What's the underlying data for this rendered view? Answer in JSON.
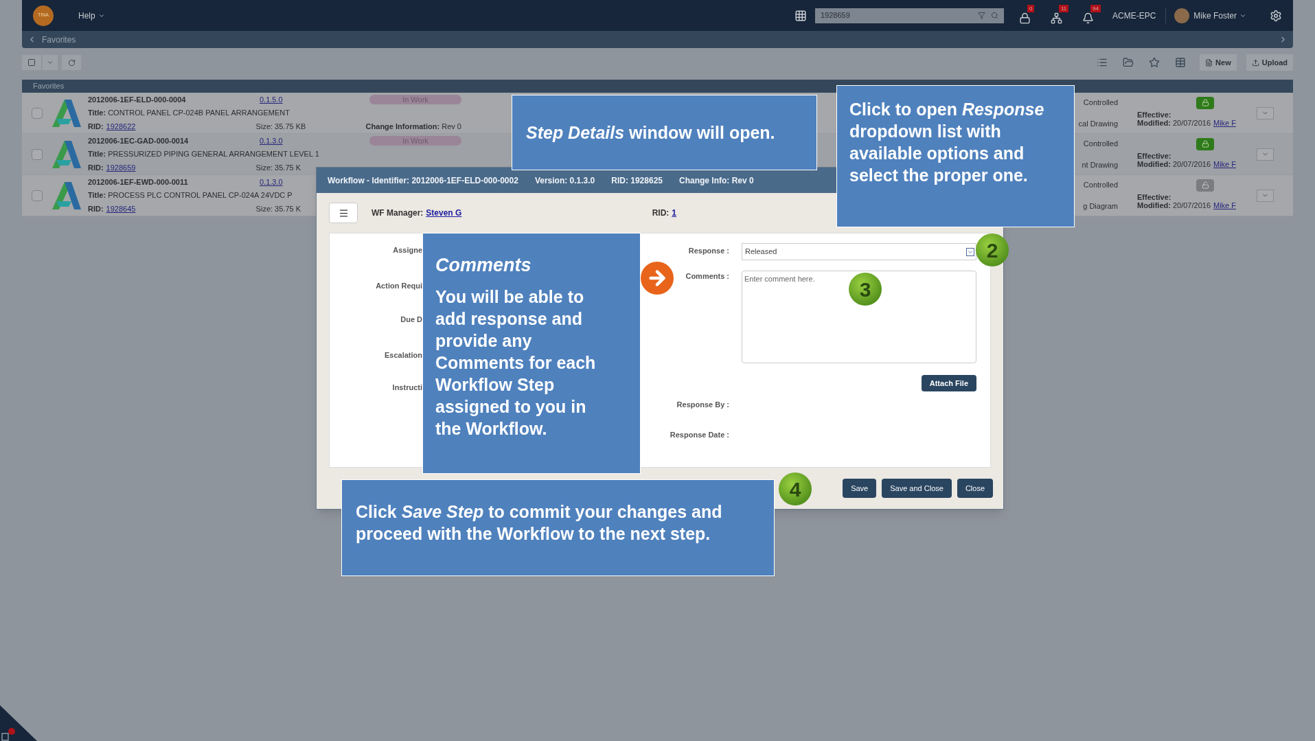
{
  "topbar": {
    "logo": "TINA",
    "help": "Help",
    "search": {
      "value": "1928659"
    },
    "badges": [
      {
        "kind": "lock",
        "count": "0"
      },
      {
        "kind": "hierarchy",
        "count": "11"
      },
      {
        "kind": "bell",
        "count": "94"
      }
    ],
    "company": "ACME-EPC",
    "user": "Mike Foster"
  },
  "breadcrumb": {
    "label": "Favorites"
  },
  "toolbar": {
    "select_all_checked": false,
    "new": "New",
    "upload": "Upload"
  },
  "panel": {
    "title": "Favorites"
  },
  "rows": [
    {
      "checked": false,
      "id": "2012006-1EF-ELD-000-0004",
      "title_label": "Title:",
      "title": "CONTROL PANEL CP-024B PANEL ARRANGEMENT",
      "rid_label": "RID:",
      "rid": "1928622",
      "version": "0.1.5.0",
      "size": "Size: 35.75 KB",
      "status": "In Work",
      "change_label": "Change Information:",
      "change": "Rev 0",
      "state": "Controlled",
      "type": "cal Drawing",
      "locked": true,
      "effective": "Effective:",
      "modified_label": "Modified:",
      "modified": "20/07/2016",
      "user": "Mike F"
    },
    {
      "checked": false,
      "id": "2012006-1EC-GAD-000-0014",
      "title_label": "Title:",
      "title": "PRESSURIZED PIPING GENERAL ARRANGEMENT LEVEL 1",
      "rid_label": "RID:",
      "rid": "1928659",
      "version": "0.1.3.0",
      "size": "Size: 35.75 K",
      "status": "In Work",
      "state": "Controlled",
      "type": "nt Drawing",
      "locked": true,
      "effective": "Effective:",
      "modified_label": "Modified:",
      "modified": "20/07/2016",
      "user": "Mike F"
    },
    {
      "checked": false,
      "id": "2012006-1EF-EWD-000-0011",
      "title_label": "Title:",
      "title": "PROCESS PLC CONTROL PANEL CP-024A 24VDC P",
      "rid_label": "RID:",
      "rid": "1928645",
      "version": "0.1.3.0",
      "size": "Size: 35.75 K",
      "state": "Controlled",
      "type": "g Diagram",
      "locked": false,
      "effective": "Effective:",
      "modified_label": "Modified:",
      "modified": "20/07/2016",
      "user": "Mike F"
    }
  ],
  "dialog": {
    "header": [
      "Workflow - Identifier: 2012006-1EF-ELD-000-0002",
      "Version: 0.1.3.0",
      "RID: 1928625",
      "Change Info: Rev 0"
    ],
    "manager_label": "WF Manager:",
    "manager": "Steven G",
    "rid_label": "RID:",
    "rid": "1",
    "left_labels": [
      "Assigne",
      "Action Requi",
      "Due D",
      "Escalation",
      "Instructi"
    ],
    "response_label": "Response :",
    "response": "Released",
    "comments_label": "Comments :",
    "comments_placeholder": "Enter comment here.",
    "attach": "Attach File",
    "response_by": "Response By :",
    "response_date": "Response Date :",
    "buttons": [
      "Save",
      "Save and Close",
      "Close"
    ]
  },
  "callouts": [
    {
      "kind": "plain",
      "text": "*Step Details* window will open."
    },
    {
      "kind": "plain",
      "text": "Click to open *Response* dropdown list with available options and select the proper one."
    },
    {
      "kind": "titled",
      "title": "Comments",
      "text": "You will be able to add response and provide any Comments for each Workflow Step assigned to you in the Workflow."
    },
    {
      "kind": "plain",
      "text": "Click *Save Step* to commit your changes and proceed with the Workflow to the next step."
    }
  ],
  "markers": [
    "2",
    "3",
    "4"
  ]
}
